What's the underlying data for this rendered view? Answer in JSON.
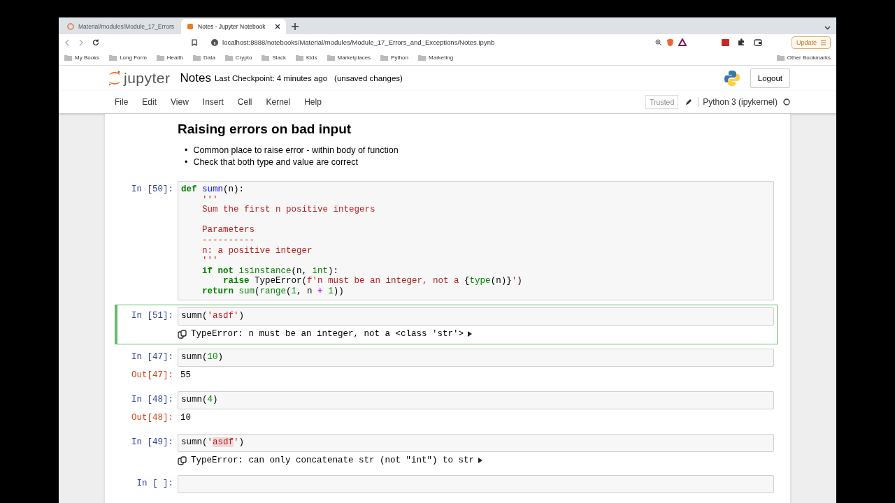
{
  "browser": {
    "tabs": [
      {
        "title": "Material/modules/Module_17_Errors",
        "selected": false
      },
      {
        "title": "Notes - Jupyter Notebook",
        "selected": true
      }
    ],
    "url": "localhost:8888/notebooks/Material/modules/Module_17_Errors_and_Exceptions/Notes.ipynb",
    "update_button": "Update",
    "bookmarks": [
      "My Books",
      "Long Form",
      "Health",
      "Data",
      "Crypto",
      "Slack",
      "Kids",
      "Marketplaces",
      "Python",
      "Marketing"
    ],
    "other_bookmarks": "Other Bookmarks"
  },
  "jupyter": {
    "logo_text": "jupyter",
    "notebook_name": "Notes",
    "checkpoint": "Last Checkpoint: 4 minutes ago",
    "unsaved": "(unsaved changes)",
    "logout": "Logout",
    "menu": [
      "File",
      "Edit",
      "View",
      "Insert",
      "Cell",
      "Kernel",
      "Help"
    ],
    "trusted": "Trusted",
    "kernel": "Python 3 (ipykernel)"
  },
  "markdown": {
    "heading": "Raising errors on bad input",
    "bullets": [
      {
        "marker": "•",
        "text": "Common place to raise error - within body of function"
      },
      {
        "marker": "•",
        "text": "Check that both type and value are correct"
      }
    ]
  },
  "cells": [
    {
      "prompt": "In [50]:",
      "selected": false,
      "lines": [
        {
          "tokens": [
            {
              "text": "def",
              "kind": "kw"
            },
            {
              "text": " sumn",
              "kind": "fn"
            },
            {
              "text": "(n):",
              "kind": "plain"
            }
          ]
        },
        {
          "tokens": [
            {
              "text": "    '''",
              "kind": "str"
            }
          ]
        },
        {
          "tokens": [
            {
              "text": "    Sum the first n positive integers",
              "kind": "str"
            }
          ]
        },
        {
          "tokens": [
            {
              "text": "    Parameters",
              "kind": "str"
            }
          ],
          "blank_before": true
        },
        {
          "tokens": [
            {
              "text": "    ----------",
              "kind": "str"
            }
          ]
        },
        {
          "tokens": [
            {
              "text": "    n: a positive integer",
              "kind": "str"
            }
          ]
        },
        {
          "tokens": [
            {
              "text": "    '''",
              "kind": "str"
            }
          ]
        },
        {
          "tokens": [
            {
              "text": "    if not",
              "kind": "kw"
            },
            {
              "text": " isinstance",
              "kind": "bi"
            },
            {
              "text": "(n, ",
              "kind": "plain"
            },
            {
              "text": "int",
              "kind": "bi"
            },
            {
              "text": "):",
              "kind": "plain"
            }
          ]
        },
        {
          "tokens": [
            {
              "text": "        raise",
              "kind": "kw"
            },
            {
              "text": " TypeError(",
              "kind": "plain"
            },
            {
              "text": "f'n must be an integer, not a ",
              "kind": "str"
            },
            {
              "text": "{",
              "kind": "plain"
            },
            {
              "text": "type",
              "kind": "bi"
            },
            {
              "text": "(n)}",
              "kind": "plain"
            },
            {
              "text": "'",
              "kind": "str"
            },
            {
              "text": ")",
              "kind": "plain"
            }
          ]
        },
        {
          "tokens": [
            {
              "text": "    return",
              "kind": "kw"
            },
            {
              "text": " sum",
              "kind": "bi"
            },
            {
              "text": "(",
              "kind": "plain"
            },
            {
              "text": "range",
              "kind": "bi"
            },
            {
              "text": "(",
              "kind": "plain"
            },
            {
              "text": "1",
              "kind": "num"
            },
            {
              "text": ", n ",
              "kind": "plain"
            },
            {
              "text": "+",
              "kind": "op"
            },
            {
              "text": " 1",
              "kind": "num"
            },
            {
              "text": "))",
              "kind": "plain"
            }
          ]
        }
      ]
    },
    {
      "prompt": "In [51]:",
      "selected": true,
      "lines": [
        {
          "tokens": [
            {
              "text": "sumn(",
              "kind": "plain"
            },
            {
              "text": "'asdf'",
              "kind": "str"
            },
            {
              "text": ")",
              "kind": "plain"
            }
          ]
        }
      ],
      "output": {
        "kind": "error",
        "text": "TypeError: n must be an integer, not a <class 'str'>"
      }
    },
    {
      "prompt": "In [47]:",
      "selected": false,
      "lines": [
        {
          "tokens": [
            {
              "text": "sumn(",
              "kind": "plain"
            },
            {
              "text": "10",
              "kind": "num"
            },
            {
              "text": ")",
              "kind": "plain"
            }
          ]
        }
      ],
      "output": {
        "kind": "result",
        "prompt": "Out[47]:",
        "text": "55"
      }
    },
    {
      "prompt": "In [48]:",
      "selected": false,
      "lines": [
        {
          "tokens": [
            {
              "text": "sumn(",
              "kind": "plain"
            },
            {
              "text": "4",
              "kind": "num"
            },
            {
              "text": ")",
              "kind": "plain"
            }
          ]
        }
      ],
      "output": {
        "kind": "result",
        "prompt": "Out[48]:",
        "text": "10"
      }
    },
    {
      "prompt": "In [49]:",
      "selected": false,
      "lines": [
        {
          "tokens": [
            {
              "text": "sumn(",
              "kind": "plain"
            },
            {
              "text": "'",
              "kind": "str"
            },
            {
              "text": "asdf",
              "kind": "strhl"
            },
            {
              "text": "'",
              "kind": "str"
            },
            {
              "text": ")",
              "kind": "plain"
            }
          ]
        }
      ],
      "output": {
        "kind": "error",
        "text": "TypeError: can only concatenate str (not \"int\") to str"
      }
    },
    {
      "prompt": "In [ ]:",
      "selected": false
    }
  ]
}
